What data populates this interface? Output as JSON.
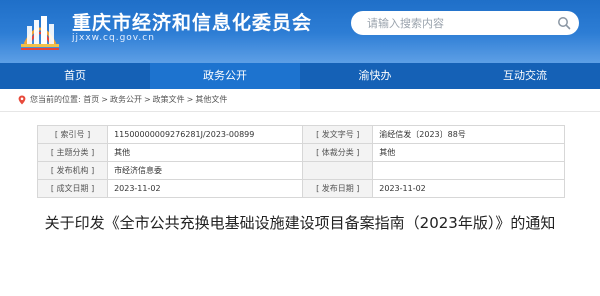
{
  "header": {
    "site_title": "重庆市经济和信息化委员会",
    "site_domain": "jjxxw.cq.gov.cn",
    "search_placeholder": "请输入搜索内容",
    "bg_color": "#1f6fc8"
  },
  "nav": {
    "items": [
      {
        "label": "首页"
      },
      {
        "label": "政务公开"
      },
      {
        "label": "渝快办"
      },
      {
        "label": "互动交流"
      }
    ]
  },
  "breadcrumb": {
    "prefix": "您当前的位置:",
    "items": [
      "首页",
      "政务公开",
      "政策文件",
      "其他文件"
    ],
    "separator": ">"
  },
  "info_table": {
    "rows": [
      {
        "l1": "[ 索引号 ]",
        "v1": "11500000009276281J/2023-00899",
        "l2": "[ 发文字号 ]",
        "v2": "渝经信发〔2023〕88号"
      },
      {
        "l1": "[ 主题分类 ]",
        "v1": "其他",
        "l2": "[ 体裁分类 ]",
        "v2": "其他"
      },
      {
        "l1": "[ 发布机构 ]",
        "v1": "市经济信息委",
        "l2": "",
        "v2": ""
      },
      {
        "l1": "[ 成文日期 ]",
        "v1": "2023-11-02",
        "l2": "[ 发布日期 ]",
        "v2": "2023-11-02"
      }
    ]
  },
  "article": {
    "title": "关于印发《全市公共充换电基础设施建设项目备案指南（2023年版）》的通知"
  }
}
